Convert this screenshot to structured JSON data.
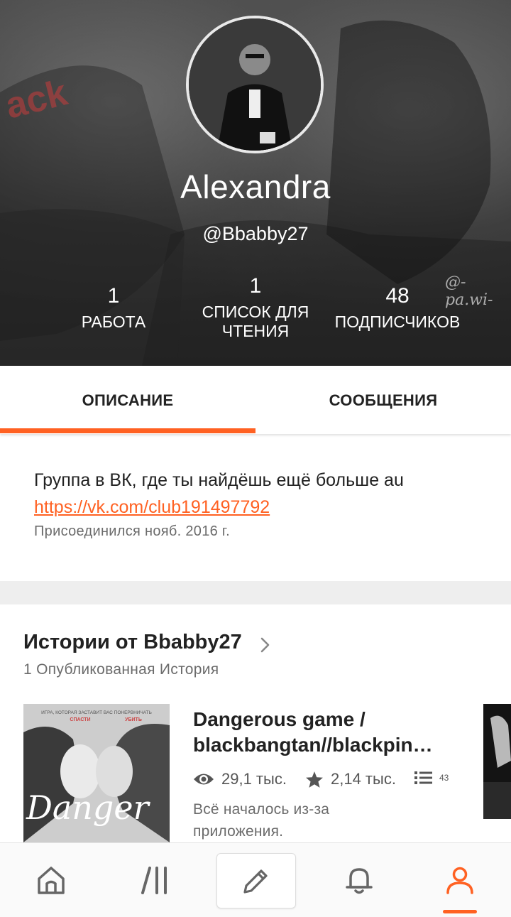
{
  "profile": {
    "name": "Alexandra",
    "handle": "@Bbabby27",
    "watermark": "@-pa.wi-",
    "stats": [
      {
        "value": "1",
        "label": "РАБОТА"
      },
      {
        "value": "1",
        "label_line1": "СПИСОК ДЛЯ",
        "label_line2": "ЧТЕНИЯ"
      },
      {
        "value": "48",
        "label": "ПОДПИСЧИКОВ"
      }
    ]
  },
  "tabs": [
    {
      "label": "ОПИСАНИЕ",
      "active": true
    },
    {
      "label": "СООБЩЕНИЯ",
      "active": false
    }
  ],
  "about": {
    "text": "Группа в ВК, где ты найдёшь ещё больше au",
    "link": "https://vk.com/club191497792",
    "joined": "Присоединился нояб. 2016 г."
  },
  "stories": {
    "title": "Истории от Bbabby27",
    "count": "1 Опубликованная История",
    "items": [
      {
        "title_line1": "Dangerous game /",
        "title_line2": "blackbangtan//blackpin…",
        "views": "29,1 тыс.",
        "votes": "2,14 тыс.",
        "parts": "43",
        "description_line1": "Всё началось из-за",
        "description_line2": "приложения.",
        "cover_text": "Danger",
        "cover_tagline": "ИГРА, КОТОРАЯ ЗАСТАВИТ ВАС ПОНЕРВНИЧАТЬ",
        "cover_words": [
          "СПАСТИ",
          "УБИТЬ"
        ]
      }
    ]
  },
  "nav": {
    "items": [
      "home-icon",
      "browse-icon",
      "write-icon",
      "notifications-icon",
      "profile-icon"
    ],
    "active": "profile-icon"
  },
  "colors": {
    "accent": "#ff6122",
    "text": "#222222",
    "muted": "#6b6b6b"
  }
}
